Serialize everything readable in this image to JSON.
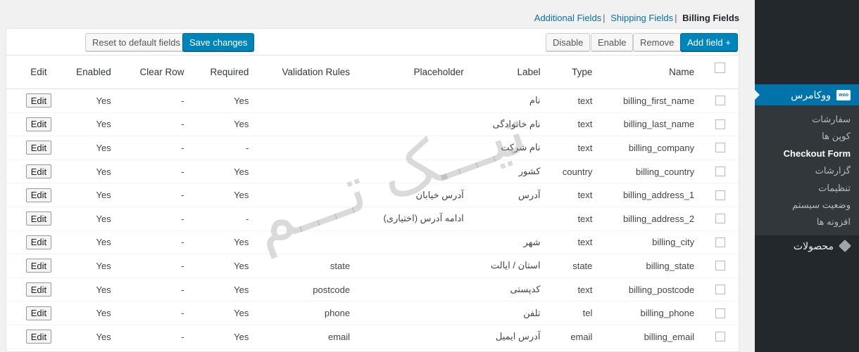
{
  "tabs": {
    "additional": "Additional Fields",
    "shipping": "Shipping Fields",
    "billing": "Billing Fields",
    "sep": "|"
  },
  "toolbar": {
    "reset": "Reset to default fields",
    "save": "Save changes",
    "disable": "Disable",
    "enable": "Enable",
    "remove": "Remove",
    "add": "Add field +"
  },
  "headers": {
    "edit": "Edit",
    "enabled": "Enabled",
    "clear_row": "Clear Row",
    "required": "Required",
    "validation": "Validation Rules",
    "placeholder": "Placeholder",
    "label": "Label",
    "type": "Type",
    "name": "Name"
  },
  "edit_label": "Edit",
  "rows": [
    {
      "enabled": "Yes",
      "clear": "-",
      "required": "Yes",
      "validation": "",
      "placeholder": "",
      "label": "نام",
      "type": "text",
      "name": "billing_first_name"
    },
    {
      "enabled": "Yes",
      "clear": "-",
      "required": "Yes",
      "validation": "",
      "placeholder": "",
      "label": "نام خانوادگی",
      "type": "text",
      "name": "billing_last_name"
    },
    {
      "enabled": "Yes",
      "clear": "-",
      "required": "-",
      "validation": "",
      "placeholder": "",
      "label": "نام شرکت",
      "type": "text",
      "name": "billing_company"
    },
    {
      "enabled": "Yes",
      "clear": "-",
      "required": "Yes",
      "validation": "",
      "placeholder": "",
      "label": "کشور",
      "type": "country",
      "name": "billing_country"
    },
    {
      "enabled": "Yes",
      "clear": "-",
      "required": "Yes",
      "validation": "",
      "placeholder": "آدرس خیابان",
      "label": "آدرس",
      "type": "text",
      "name": "billing_address_1"
    },
    {
      "enabled": "Yes",
      "clear": "-",
      "required": "-",
      "validation": "",
      "placeholder": "ادامه آدرس (اختیاری)",
      "label": "",
      "type": "text",
      "name": "billing_address_2"
    },
    {
      "enabled": "Yes",
      "clear": "-",
      "required": "Yes",
      "validation": "",
      "placeholder": "",
      "label": "شهر",
      "type": "text",
      "name": "billing_city"
    },
    {
      "enabled": "Yes",
      "clear": "-",
      "required": "Yes",
      "validation": "state",
      "placeholder": "",
      "label": "استان / ایالت",
      "type": "state",
      "name": "billing_state"
    },
    {
      "enabled": "Yes",
      "clear": "-",
      "required": "Yes",
      "validation": "postcode",
      "placeholder": "",
      "label": "کدپستی",
      "type": "text",
      "name": "billing_postcode"
    },
    {
      "enabled": "Yes",
      "clear": "-",
      "required": "Yes",
      "validation": "phone",
      "placeholder": "",
      "label": "تلفن",
      "type": "tel",
      "name": "billing_phone"
    },
    {
      "enabled": "Yes",
      "clear": "-",
      "required": "Yes",
      "validation": "email",
      "placeholder": "",
      "label": "آدرس ایمیل",
      "type": "email",
      "name": "billing_email"
    }
  ],
  "watermark": "تیـــک تـــم",
  "sidebar": {
    "woocommerce": "ووکامرس",
    "woo_badge": "woo",
    "items": [
      "سفارشات",
      "کوپن ها",
      "Checkout Form",
      "گزارشات",
      "تنظیمات",
      "وضعیت سیستم",
      "افزونه ها"
    ],
    "current_index": 2,
    "products": "محصولات"
  },
  "colors": {
    "accent": "#0085ba",
    "sidebar": "#23282d",
    "link": "#0073aa"
  }
}
